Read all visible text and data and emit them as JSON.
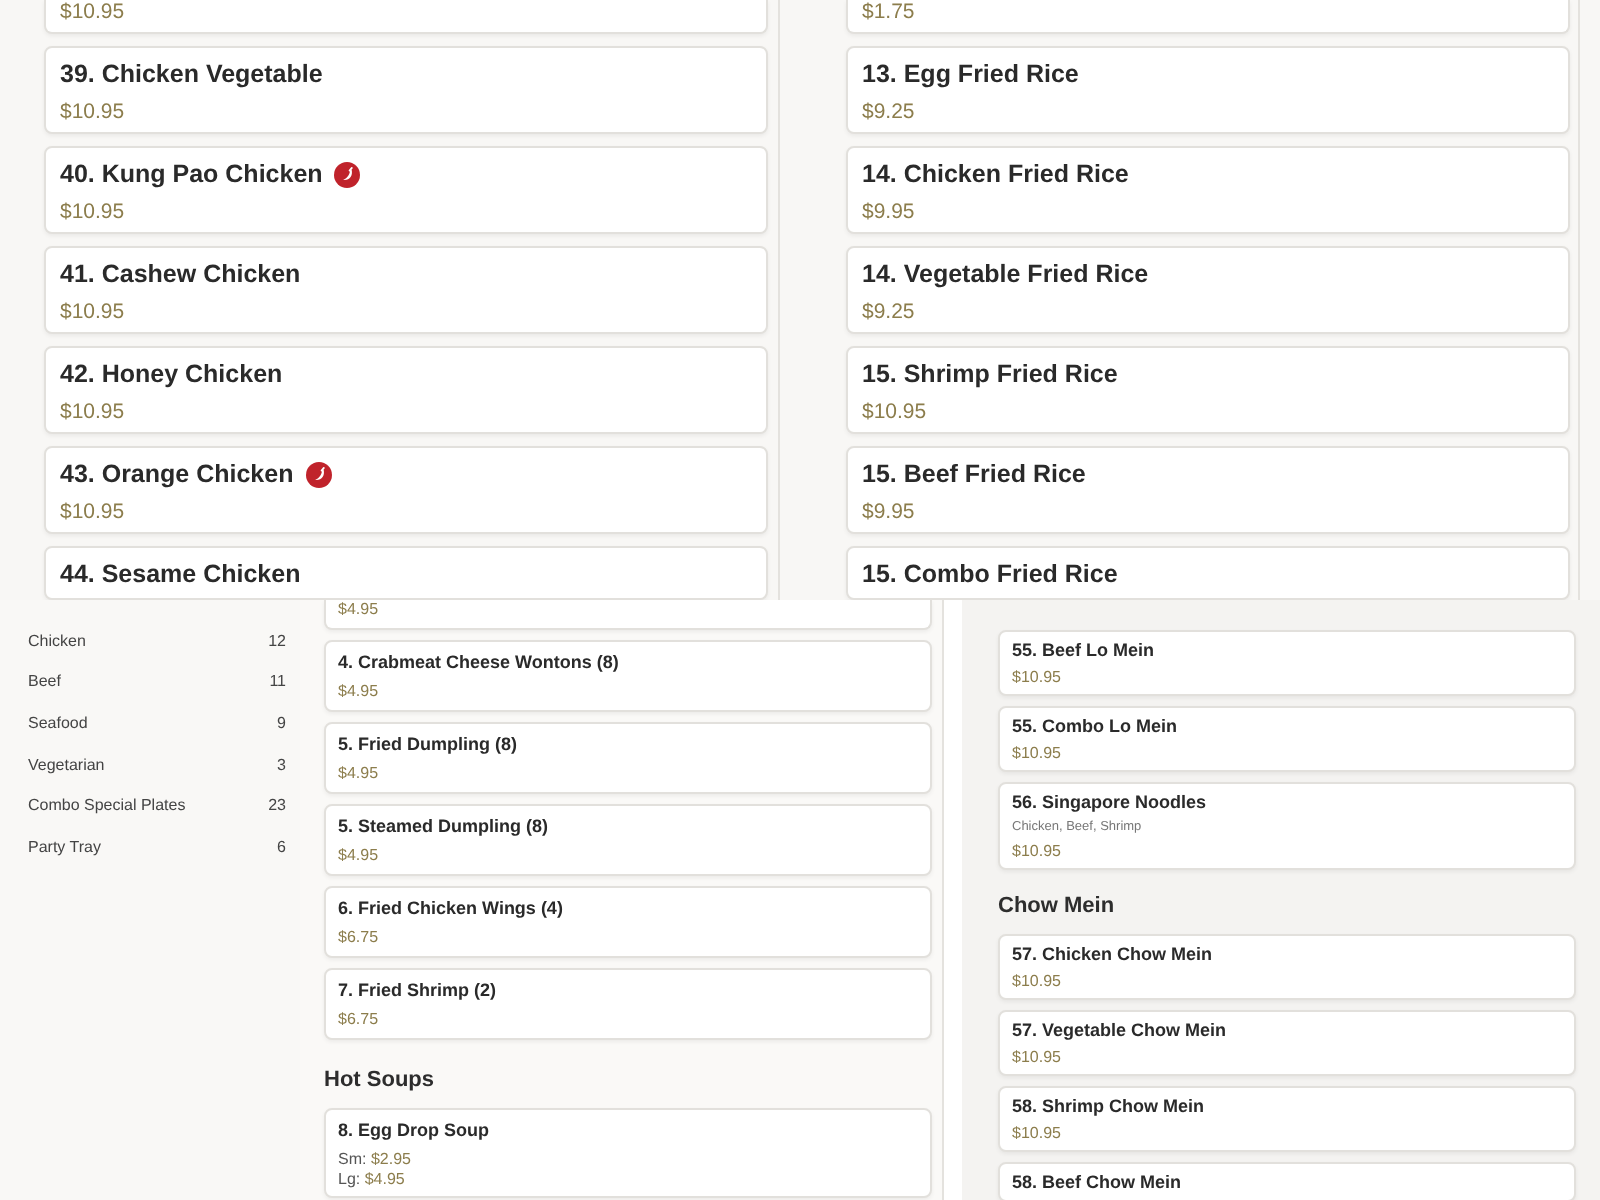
{
  "top_panel": {
    "left_column": [
      {
        "kind": "card",
        "price": "$10.95"
      },
      {
        "kind": "card",
        "title": "39. Chicken Vegetable",
        "price": "$10.95",
        "spicy": false
      },
      {
        "kind": "card",
        "title": "40. Kung Pao Chicken",
        "price": "$10.95",
        "spicy": true
      },
      {
        "kind": "card",
        "title": "41. Cashew Chicken",
        "price": "$10.95",
        "spicy": false
      },
      {
        "kind": "card",
        "title": "42. Honey Chicken",
        "price": "$10.95",
        "spicy": false
      },
      {
        "kind": "card",
        "title": "43. Orange Chicken",
        "price": "$10.95",
        "spicy": true
      },
      {
        "kind": "card",
        "title": "44. Sesame Chicken",
        "spicy": false
      }
    ],
    "right_column": [
      {
        "kind": "card",
        "price": "$1.75"
      },
      {
        "kind": "card",
        "title": "13. Egg Fried Rice",
        "price": "$9.25",
        "spicy": false
      },
      {
        "kind": "card",
        "title": "14. Chicken Fried Rice",
        "price": "$9.95",
        "spicy": false
      },
      {
        "kind": "card",
        "title": "14. Vegetable Fried Rice",
        "price": "$9.25",
        "spicy": false
      },
      {
        "kind": "card",
        "title": "15. Shrimp Fried Rice",
        "price": "$10.95",
        "spicy": false
      },
      {
        "kind": "card",
        "title": "15. Beef Fried Rice",
        "price": "$9.95",
        "spicy": false
      },
      {
        "kind": "card",
        "title": "15. Combo Fried Rice",
        "spicy": false
      }
    ]
  },
  "bottom_panel": {
    "categories": [
      {
        "name": "Chicken",
        "count": "12"
      },
      {
        "name": "Beef",
        "count": "11"
      },
      {
        "name": "Seafood",
        "count": "9"
      },
      {
        "name": "Vegetarian",
        "count": "3"
      },
      {
        "name": "Combo Special Plates",
        "count": "23"
      },
      {
        "name": "Party Tray",
        "count": "6"
      }
    ],
    "middle_column": [
      {
        "kind": "card",
        "price": "$4.95"
      },
      {
        "kind": "card",
        "title": "4. Crabmeat Cheese Wontons (8)",
        "price": "$4.95"
      },
      {
        "kind": "card",
        "title": "5. Fried Dumpling (8)",
        "price": "$4.95"
      },
      {
        "kind": "card",
        "title": "5. Steamed Dumpling (8)",
        "price": "$4.95"
      },
      {
        "kind": "card",
        "title": "6. Fried Chicken Wings (4)",
        "price": "$6.75"
      },
      {
        "kind": "card",
        "title": "7. Fried Shrimp (2)",
        "price": "$6.75"
      },
      {
        "kind": "heading",
        "title": "Hot Soups"
      },
      {
        "kind": "card",
        "title": "8. Egg Drop Soup",
        "prices": [
          {
            "label": "Sm:",
            "amount": "$2.95"
          },
          {
            "label": "Lg:",
            "amount": "$4.95"
          }
        ]
      }
    ],
    "right_column": [
      {
        "kind": "card",
        "title": "55. Beef Lo Mein",
        "price": "$10.95"
      },
      {
        "kind": "card",
        "title": "55. Combo Lo Mein",
        "price": "$10.95"
      },
      {
        "kind": "card",
        "title": "56. Singapore Noodles",
        "description": "Chicken, Beef, Shrimp",
        "price": "$10.95"
      },
      {
        "kind": "heading",
        "title": "Chow Mein"
      },
      {
        "kind": "card",
        "title": "57. Chicken Chow Mein",
        "price": "$10.95"
      },
      {
        "kind": "card",
        "title": "57. Vegetable Chow Mein",
        "price": "$10.95"
      },
      {
        "kind": "card",
        "title": "58. Shrimp Chow Mein",
        "price": "$10.95"
      },
      {
        "kind": "card",
        "title": "58. Beef Chow Mein"
      }
    ]
  }
}
